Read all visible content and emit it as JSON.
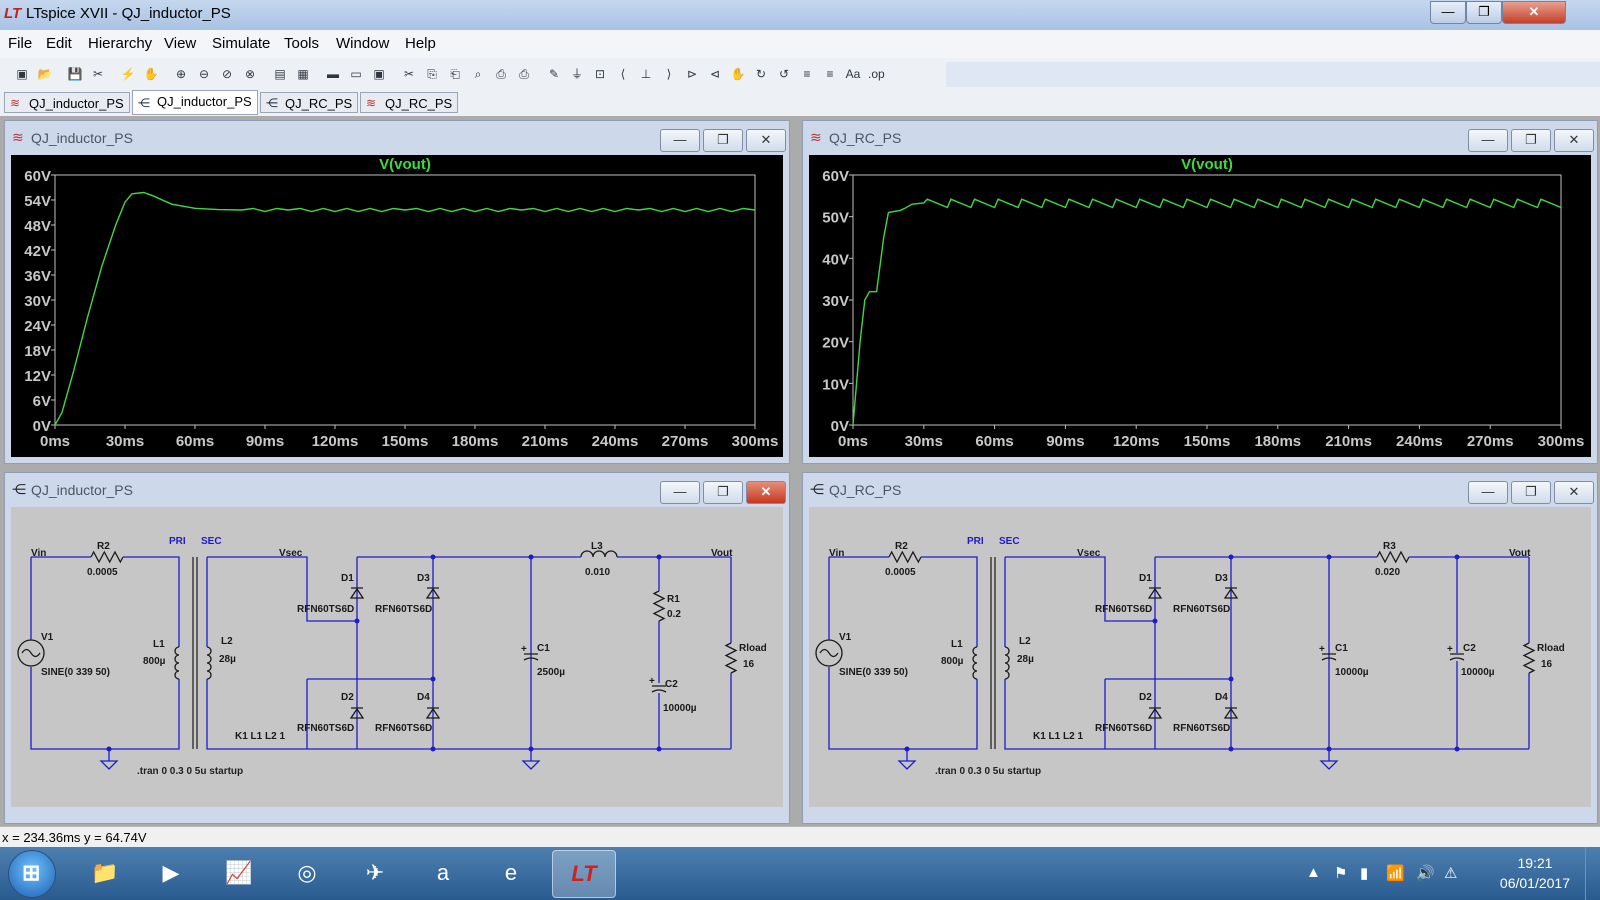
{
  "window": {
    "title": "LTspice XVII - QJ_inductor_PS",
    "minimize": "—",
    "restore": "❐",
    "close": "✕"
  },
  "menu": [
    "File",
    "Edit",
    "Hierarchy",
    "View",
    "Simulate",
    "Tools",
    "Window",
    "Help"
  ],
  "tabs": [
    {
      "label": "QJ_inductor_PS",
      "kind": "waveform"
    },
    {
      "label": "QJ_inductor_PS",
      "kind": "schematic",
      "active": true
    },
    {
      "label": "QJ_RC_PS",
      "kind": "schematic"
    },
    {
      "label": "QJ_RC_PS",
      "kind": "waveform"
    }
  ],
  "panes": {
    "plot_left": {
      "title": "QJ_inductor_PS",
      "trace": "V(vout)"
    },
    "plot_right": {
      "title": "QJ_RC_PS",
      "trace": "V(vout)"
    },
    "schem_left": {
      "title": "QJ_inductor_PS"
    },
    "schem_right": {
      "title": "QJ_RC_PS"
    }
  },
  "chart_data": [
    {
      "type": "line",
      "title": "V(vout)",
      "xlabel": "",
      "ylabel": "",
      "xlim": [
        0,
        300
      ],
      "ylim": [
        0,
        60
      ],
      "x_ticks": [
        "0ms",
        "30ms",
        "60ms",
        "90ms",
        "120ms",
        "150ms",
        "180ms",
        "210ms",
        "240ms",
        "270ms",
        "300ms"
      ],
      "y_ticks": [
        "0V",
        "6V",
        "12V",
        "18V",
        "24V",
        "30V",
        "36V",
        "42V",
        "48V",
        "54V",
        "60V"
      ],
      "series": [
        {
          "color": "#40d840",
          "x": [
            0,
            3,
            8,
            14,
            20,
            26,
            30,
            33,
            38,
            42,
            50,
            60,
            70,
            80,
            100,
            150,
            200,
            250,
            300
          ],
          "y": [
            0,
            3,
            13,
            26,
            38,
            48,
            53.5,
            55.5,
            55.8,
            55,
            53,
            52,
            51.7,
            51.6,
            51.6,
            51.6,
            51.6,
            51.6,
            51.6
          ]
        }
      ]
    },
    {
      "type": "line",
      "title": "V(vout)",
      "xlabel": "",
      "ylabel": "",
      "xlim": [
        0,
        300
      ],
      "ylim": [
        0,
        60
      ],
      "x_ticks": [
        "0ms",
        "30ms",
        "60ms",
        "90ms",
        "120ms",
        "150ms",
        "180ms",
        "210ms",
        "240ms",
        "270ms",
        "300ms"
      ],
      "y_ticks": [
        "0V",
        "10V",
        "20V",
        "30V",
        "40V",
        "50V",
        "60V"
      ],
      "series": [
        {
          "color": "#40d840",
          "x": [
            0,
            3,
            5,
            7,
            10,
            13,
            15,
            20,
            22,
            25,
            30,
            35,
            40
          ],
          "y": [
            0,
            20,
            30,
            32,
            32,
            45,
            51,
            51.5,
            52,
            53,
            53.3,
            53.5,
            53.6
          ],
          "ripple": {
            "period_ms": 10,
            "low": 52.2,
            "high": 54.2,
            "from_ms": 30
          }
        }
      ]
    }
  ],
  "schematic": {
    "common": {
      "vin": "Vin",
      "r2": "R2",
      "r2_val": "0.0005",
      "pri": "PRI",
      "sec": "SEC",
      "vsec": "Vsec",
      "v1": "V1",
      "v1_val": "SINE(0 339 50)",
      "l1": "L1",
      "l1_val": "800µ",
      "l2": "L2",
      "l2_val": "28µ",
      "k": "K1 L1 L2 1",
      "d1": "D1",
      "d2": "D2",
      "d3": "D3",
      "d4": "D4",
      "dmodel": "RFN60TS6D",
      "vout": "Vout",
      "rload": "Rload",
      "rload_val": "16",
      "tran": ".tran 0 0.3 0 5u startup"
    },
    "left": {
      "l3": "L3",
      "l3_val": "0.010",
      "r1": "R1",
      "r1_val": "0.2",
      "c1": "C1",
      "c1_val": "2500µ",
      "c2": "C2",
      "c2_val": "10000µ"
    },
    "right": {
      "r3": "R3",
      "r3_val": "0.020",
      "c1": "C1",
      "c1_val": "10000µ",
      "c2": "C2",
      "c2_val": "10000µ"
    }
  },
  "status": "x = 234.36ms    y = 64.74V",
  "taskbar": {
    "time": "19:21",
    "date": "06/01/2017"
  }
}
